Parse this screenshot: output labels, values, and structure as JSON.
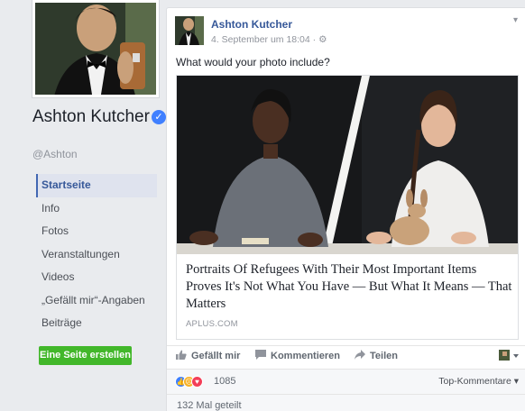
{
  "profile": {
    "name": "Ashton Kutcher",
    "handle": "@Ashton"
  },
  "nav": {
    "items": [
      "Startseite",
      "Info",
      "Fotos",
      "Veranstaltungen",
      "Videos",
      "„Gefällt mir“-Angaben",
      "Beiträge"
    ],
    "active_index": 0
  },
  "create_page_label": "Eine Seite erstellen",
  "post": {
    "author": "Ashton Kutcher",
    "timestamp": "4. September um 18:04",
    "text": "What would your photo include?",
    "link": {
      "title": "Portraits Of Refugees With Their Most Important Items Proves It's Not What You Have — But What It Means — That Matters",
      "domain": "APLUS.COM"
    },
    "actions": {
      "like": "Gefällt mir",
      "comment": "Kommentieren",
      "share": "Teilen"
    },
    "reactions": {
      "count": "1085",
      "types": [
        "like-icon",
        "sad-icon",
        "love-icon"
      ],
      "sort_label": "Top-Kommentare"
    },
    "shares_text": "132 Mal geteilt"
  },
  "colors": {
    "link_blue": "#365899",
    "green_button": "#42b72a",
    "verified_blue": "#4080ff",
    "page_bg": "#e9ebee"
  }
}
